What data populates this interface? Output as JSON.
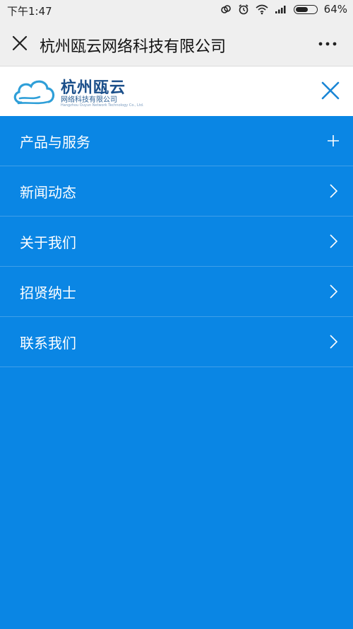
{
  "status_bar": {
    "time": "下午1:47",
    "battery_percent": "64%",
    "battery_level": 0.64
  },
  "title_bar": {
    "title": "杭州瓯云网络科技有限公司"
  },
  "header": {
    "logo_name": "杭州瓯云",
    "logo_subtitle": "网络科技有限公司",
    "logo_english": "Hangzhou Ouyun Network Technology Co., Ltd."
  },
  "menu": {
    "items": [
      {
        "label": "产品与服务",
        "icon": "plus-icon"
      },
      {
        "label": "新闻动态",
        "icon": "chevron-right-icon"
      },
      {
        "label": "关于我们",
        "icon": "chevron-right-icon"
      },
      {
        "label": "招贤纳士",
        "icon": "chevron-right-icon"
      },
      {
        "label": "联系我们",
        "icon": "chevron-right-icon"
      }
    ]
  },
  "colors": {
    "menu_background": "#0a86e4",
    "menu_divider": "#3f9fe9",
    "header_background": "#ffffff",
    "logo_blue": "#1b4f8a",
    "close_icon_blue": "#1a86d6",
    "bar_background": "#efefef"
  }
}
